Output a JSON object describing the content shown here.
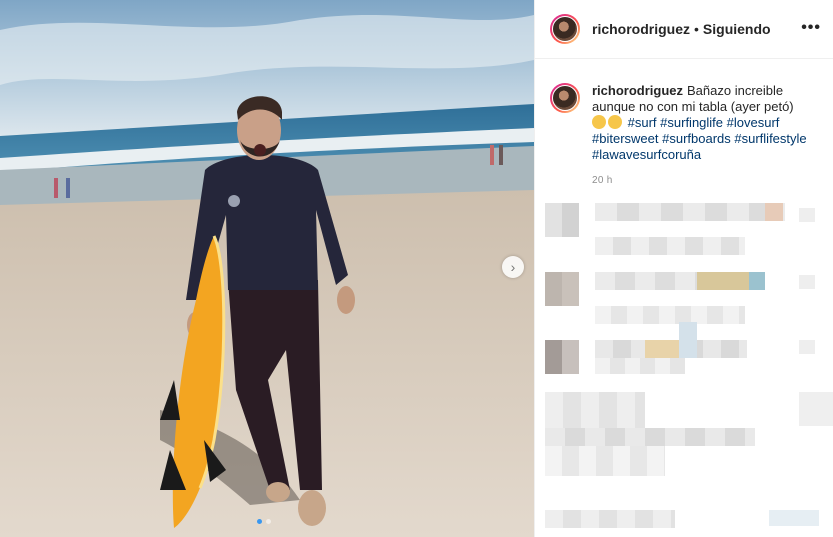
{
  "post": {
    "username": "richorodriguez",
    "separator": "•",
    "follow_status": "Siguiendo",
    "more_label": "•••",
    "caption_text": "Bañazo increible aunque no con mi tabla (ayer petó)",
    "hashtags": [
      "#surf",
      "#surfinglife",
      "#lovesurf",
      "#bitersweet",
      "#surfboards",
      "#surflifestyle",
      "#lawavesurfcoruña"
    ],
    "emojis": [
      "worried-face-emoji",
      "worried-face-emoji"
    ],
    "time_ago": "20 h"
  },
  "carousel": {
    "next_icon": "›",
    "slide_count": 2,
    "active_slide": 1
  },
  "colors": {
    "link": "#00376b",
    "text": "#262626",
    "muted": "#8e8e8e",
    "carousel_active": "#3897f0"
  }
}
